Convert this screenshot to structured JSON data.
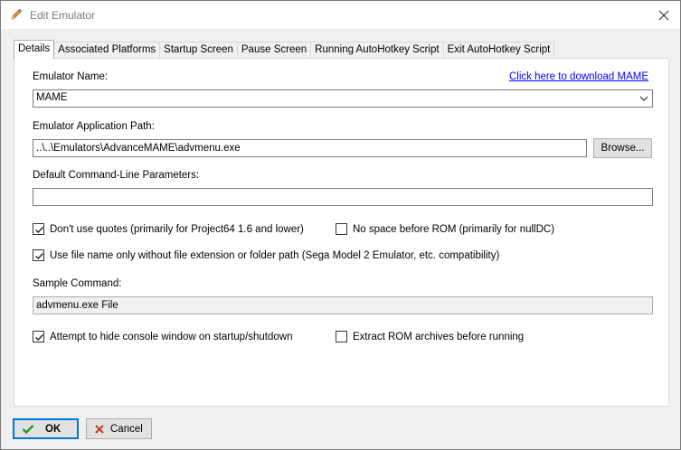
{
  "window": {
    "title": "Edit Emulator"
  },
  "tabs": [
    {
      "label": "Details"
    },
    {
      "label": "Associated Platforms"
    },
    {
      "label": "Startup Screen"
    },
    {
      "label": "Pause Screen"
    },
    {
      "label": "Running AutoHotkey Script"
    },
    {
      "label": "Exit AutoHotkey Script"
    }
  ],
  "details": {
    "name_label": "Emulator Name:",
    "download_link": "Click here to download MAME",
    "name_value": "MAME",
    "path_label": "Emulator Application Path:",
    "path_value": "..\\..\\Emulators\\AdvanceMAME\\advmenu.exe",
    "browse_label": "Browse...",
    "params_label": "Default Command-Line Parameters:",
    "params_value": "",
    "no_quotes_label": "Don't use quotes (primarily for Project64 1.6 and lower)",
    "no_quotes_checked": true,
    "no_space_label": "No space before ROM (primarily for nullDC)",
    "no_space_checked": false,
    "filename_only_label": "Use file name only without file extension or folder path (Sega Model 2 Emulator, etc. compatibility)",
    "filename_only_checked": true,
    "sample_label": "Sample Command:",
    "sample_value": "advmenu.exe File",
    "hide_console_label": "Attempt to hide console window on startup/shutdown",
    "hide_console_checked": true,
    "extract_label": "Extract ROM archives before running",
    "extract_checked": false
  },
  "footer": {
    "ok_label": "OK",
    "cancel_label": "Cancel"
  },
  "colors": {
    "ok_check": "#1e9e1e",
    "cancel_x": "#c0392b",
    "link": "#0000ff",
    "focus": "#0078d7"
  }
}
